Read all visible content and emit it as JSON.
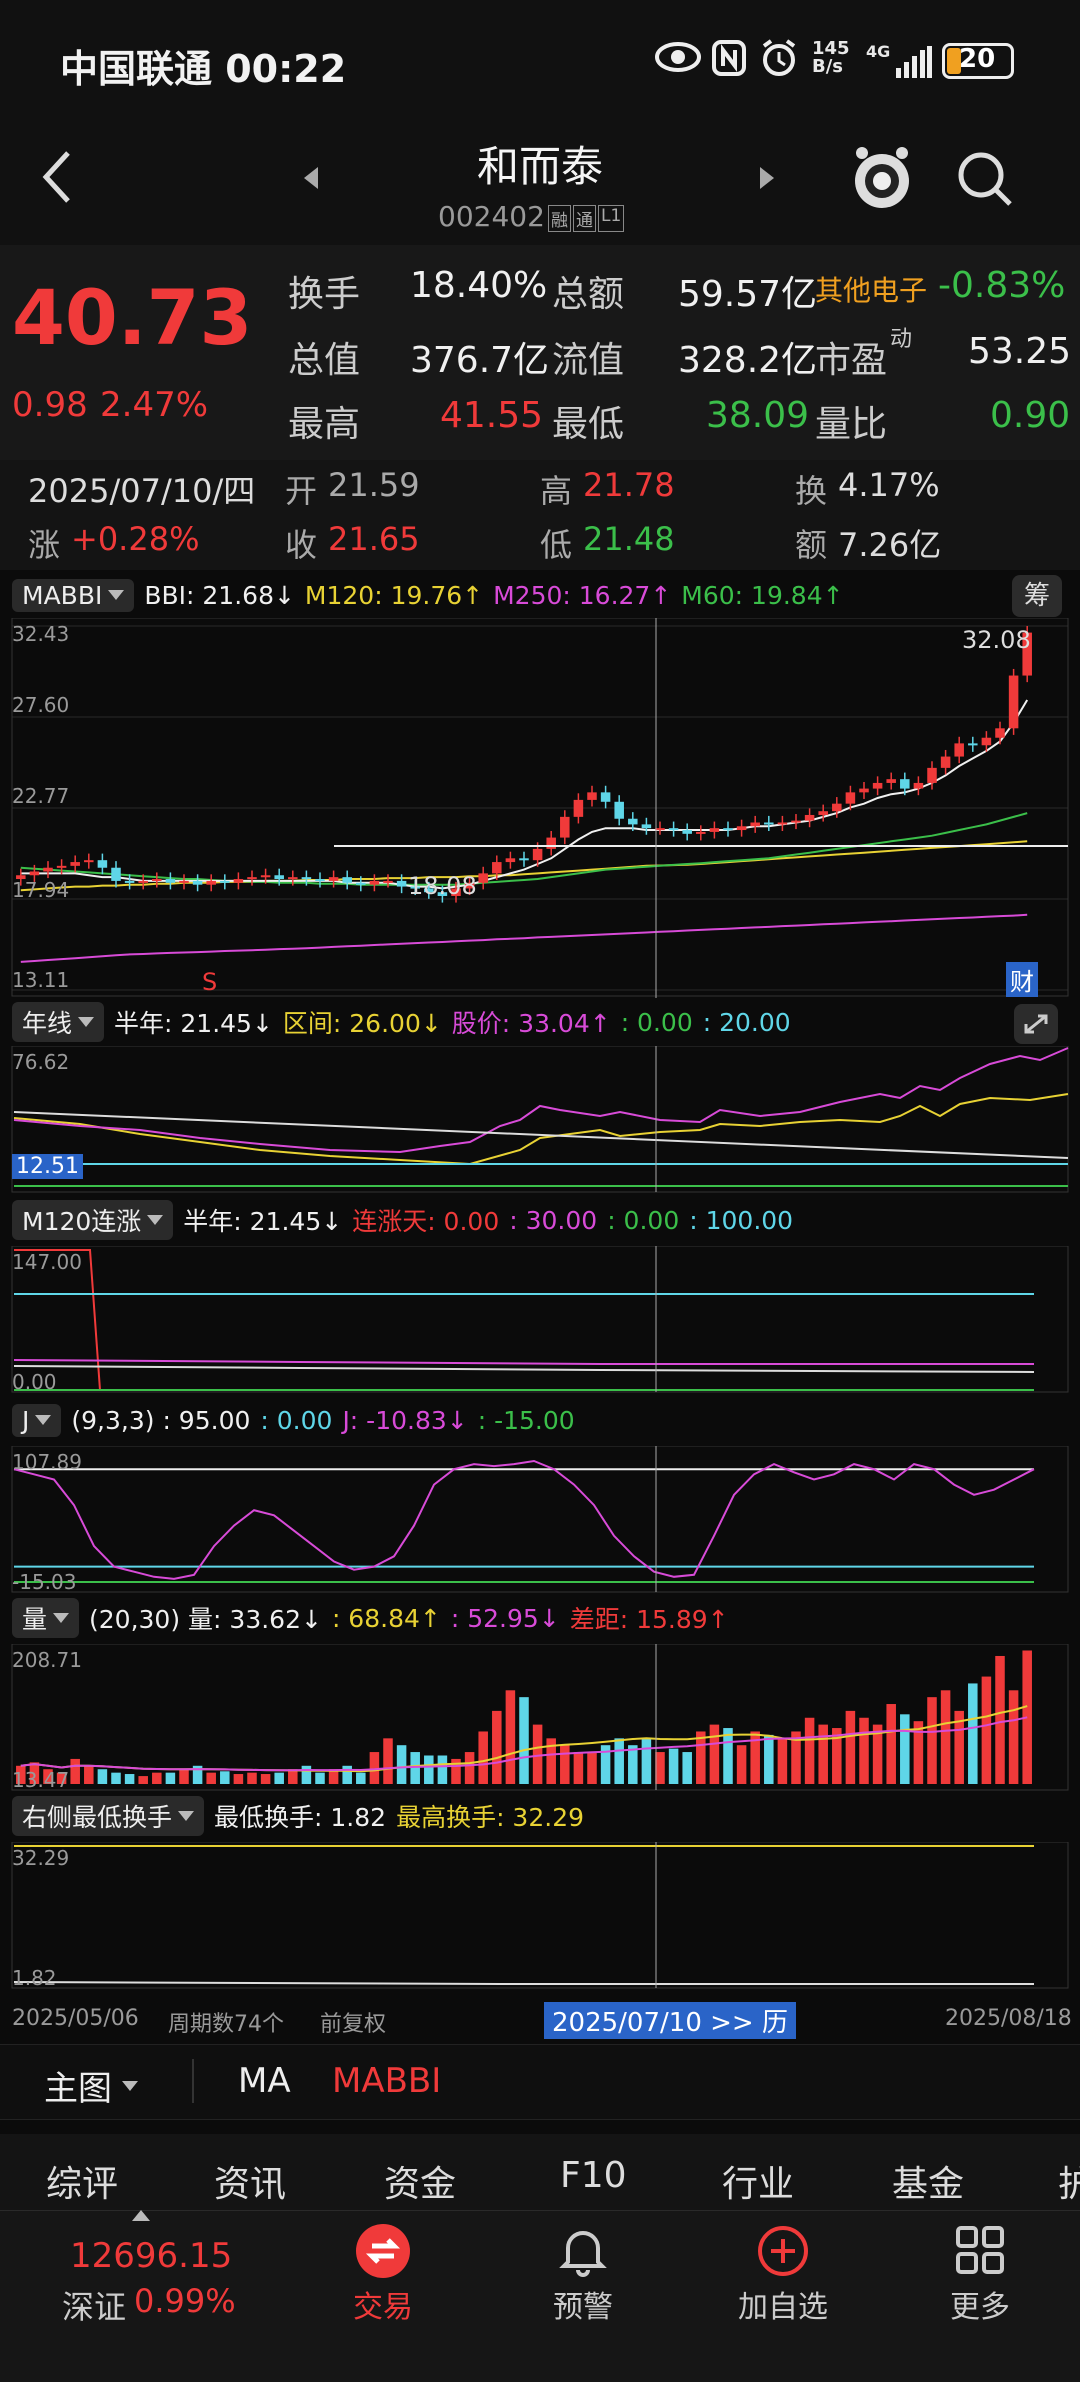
{
  "status": {
    "carrier_time": "中国联通 00:22",
    "net_speed": "145\nB/s",
    "net_type": "4G",
    "battery": "20"
  },
  "header": {
    "title": "和而泰",
    "code": "002402",
    "tags": [
      "融",
      "通",
      "L1"
    ]
  },
  "quote": {
    "price": "40.73",
    "change": "0.98",
    "change_pct": "2.47%",
    "rows": [
      [
        {
          "k": "换手",
          "v": "18.40%"
        },
        {
          "k": "总额",
          "v": "59.57亿"
        },
        {
          "k": "其他电子",
          "v": "-0.83%"
        }
      ],
      [
        {
          "k": "总值",
          "v": "376.7亿"
        },
        {
          "k": "流值",
          "v": "328.2亿"
        },
        {
          "k": "市盈",
          "sup": "动",
          "v": "53.25"
        }
      ],
      [
        {
          "k": "最高",
          "v": "41.55"
        },
        {
          "k": "最低",
          "v": "38.09"
        },
        {
          "k": "量比",
          "v": "0.90"
        }
      ]
    ]
  },
  "kinfo": {
    "date": "2025/07/10/四",
    "open_k": "开",
    "open_v": "21.59",
    "high_k": "高",
    "high_v": "21.78",
    "turn_k": "换",
    "turn_v": "4.17%",
    "chg_k": "涨",
    "chg_v": "+0.28%",
    "close_k": "收",
    "close_v": "21.65",
    "low_k": "低",
    "low_v": "21.48",
    "amt_k": "额",
    "amt_v": "7.26亿"
  },
  "main_panel": {
    "selector": "MABBI",
    "bbi": "BBI: 21.68↓",
    "m120": "M120: 19.76↑",
    "m250": "M250: 16.27↑",
    "m60": "M60: 19.84↑",
    "chip_btn": "筹",
    "y_labels": [
      "32.43",
      "27.60",
      "22.77",
      "17.94",
      "13.11"
    ],
    "max_label": "32.08",
    "min_label": "18.08",
    "s_mark": "S",
    "cai_mark": "财"
  },
  "panel2": {
    "selector": "年线",
    "p1": "半年: 21.45↓",
    "p2": "区间: 26.00↓",
    "p3": "股价: 33.04↑",
    "p4": ": 0.00",
    "p5": ": 20.00",
    "y_top": "76.62",
    "y_bot": "12.51"
  },
  "panel3": {
    "selector": "M120连涨",
    "p1": "半年: 21.45↓",
    "p2": "连涨天: 0.00",
    "p3": ": 30.00",
    "p4": ": 0.00",
    "p5": ": 100.00",
    "y_top": "147.00",
    "y_bot": "0.00"
  },
  "panel4": {
    "selector": "J",
    "p1": "(9,3,3) : 95.00",
    "p2": ": 0.00",
    "p3": "J: -10.83↓",
    "p4": ": -15.00",
    "y_top": "107.89",
    "y_bot": "-15.03"
  },
  "panel5": {
    "selector": "量",
    "p1": "(20,30) 量: 33.62↓",
    "p2": ": 68.84↑",
    "p3": ": 52.95↓",
    "p4": "差距: 15.89↑",
    "y_top": "208.71",
    "y_bot": "13.47"
  },
  "panel6": {
    "selector": "右侧最低换手",
    "p1": "最低换手: 1.82",
    "p2": "最高换手: 32.29",
    "y_top": "32.29",
    "y_bot": "1.82"
  },
  "footer_axis": {
    "start": "2025/05/06",
    "period": "周期数74个",
    "adj": "前复权",
    "cursor": "2025/07/10 >> 历",
    "end": "2025/08/18"
  },
  "toolbar": {
    "main": "主图",
    "ma": "MA",
    "mabbi": "MABBI"
  },
  "tabs": [
    "综评",
    "资讯",
    "资金",
    "F10",
    "行业",
    "基金",
    "护"
  ],
  "bottom": {
    "index_val": "12696.15",
    "index_name": "深证",
    "index_pct": "0.99%",
    "items": [
      "交易",
      "预警",
      "加自选",
      "更多"
    ]
  },
  "colors": {
    "up": "#f03a3a",
    "down": "#3bbf4a",
    "cyan": "#5fd6e8",
    "yellow": "#e8d234",
    "magenta": "#d84bd8"
  },
  "chart_data": {
    "type": "candlestick",
    "ylim": [
      13.11,
      32.43
    ],
    "closes": [
      19.2,
      19.4,
      19.6,
      19.7,
      19.9,
      20.0,
      19.6,
      18.9,
      18.8,
      18.9,
      19.0,
      18.8,
      18.9,
      18.7,
      18.9,
      18.8,
      19.0,
      19.1,
      19.2,
      19.0,
      19.1,
      19.0,
      18.9,
      19.1,
      18.8,
      18.7,
      18.9,
      18.9,
      18.6,
      18.5,
      18.3,
      18.1,
      18.5,
      18.8,
      19.3,
      19.9,
      20.1,
      20.0,
      20.6,
      21.2,
      22.3,
      23.2,
      23.6,
      23.1,
      22.2,
      21.9,
      21.7,
      21.7,
      21.6,
      21.4,
      21.5,
      21.7,
      21.6,
      21.8,
      22.0,
      21.9,
      22.0,
      22.1,
      22.4,
      22.6,
      23.0,
      23.6,
      23.8,
      24.1,
      24.3,
      23.8,
      24.1,
      24.9,
      25.5,
      26.2,
      26.1,
      26.5,
      27.0,
      29.8,
      32.08
    ],
    "volume": [
      40,
      45,
      35,
      30,
      50,
      40,
      35,
      30,
      28,
      25,
      30,
      30,
      35,
      40,
      30,
      32,
      28,
      30,
      28,
      30,
      35,
      40,
      30,
      35,
      40,
      30,
      60,
      80,
      70,
      60,
      55,
      55,
      50,
      60,
      90,
      120,
      150,
      140,
      100,
      80,
      70,
      60,
      60,
      70,
      80,
      70,
      80,
      60,
      65,
      60,
      90,
      100,
      95,
      70,
      90,
      85,
      80,
      90,
      110,
      100,
      95,
      120,
      110,
      100,
      130,
      115,
      105,
      140,
      150,
      120,
      160,
      170,
      200,
      150,
      208
    ],
    "bbi": [
      19.3,
      19.3,
      19.3,
      19.3,
      19.3,
      19.2,
      19.1,
      19.1,
      19.0,
      18.9,
      18.9,
      18.9,
      18.9,
      18.9,
      18.9,
      18.9,
      18.9,
      18.9,
      18.9,
      18.9,
      18.9,
      18.9,
      18.9,
      18.9,
      18.8,
      18.8,
      18.8,
      18.8,
      18.7,
      18.6,
      18.6,
      18.5,
      18.6,
      18.7,
      18.9,
      19.1,
      19.3,
      19.5,
      19.8,
      20.1,
      20.6,
      21.1,
      21.5,
      21.7,
      21.7,
      21.7,
      21.6,
      21.6,
      21.6,
      21.6,
      21.6,
      21.6,
      21.6,
      21.7,
      21.8,
      21.8,
      21.9,
      22.0,
      22.1,
      22.3,
      22.5,
      22.8,
      23.0,
      23.3,
      23.5,
      23.6,
      23.8,
      24.1,
      24.5,
      25.0,
      25.4,
      25.8,
      26.3,
      27.3,
      28.5
    ],
    "m60": [
      19.6,
      19.55,
      19.5,
      19.45,
      19.4,
      19.35,
      19.3,
      19.25,
      19.2,
      19.15,
      19.1,
      19.05,
      19.0,
      19.0,
      18.95,
      18.9,
      18.9,
      18.85,
      18.85,
      18.8,
      18.8,
      18.8,
      18.75,
      18.75,
      18.75,
      18.7,
      18.7,
      18.7,
      18.7,
      18.7,
      18.7,
      18.7,
      18.7,
      18.75,
      18.8,
      18.85,
      18.9,
      18.95,
      19.0,
      19.1,
      19.2,
      19.3,
      19.4,
      19.5,
      19.55,
      19.6,
      19.65,
      19.7,
      19.75,
      19.8,
      19.84,
      19.9,
      19.95,
      20.0,
      20.05,
      20.1,
      20.2,
      20.3,
      20.4,
      20.5,
      20.6,
      20.7,
      20.8,
      20.9,
      21.0,
      21.1,
      21.2,
      21.3,
      21.45,
      21.6,
      21.75,
      21.9,
      22.1,
      22.3,
      22.5
    ],
    "m120": [
      18.4,
      18.45,
      18.5,
      18.55,
      18.6,
      18.6,
      18.65,
      18.65,
      18.7,
      18.7,
      18.75,
      18.75,
      18.8,
      18.8,
      18.8,
      18.85,
      18.85,
      18.85,
      18.9,
      18.9,
      18.9,
      18.95,
      18.95,
      18.95,
      19.0,
      19.0,
      19.0,
      19.05,
      19.05,
      19.05,
      19.1,
      19.1,
      19.1,
      19.15,
      19.15,
      19.2,
      19.2,
      19.25,
      19.3,
      19.35,
      19.4,
      19.45,
      19.5,
      19.55,
      19.6,
      19.65,
      19.7,
      19.72,
      19.74,
      19.76,
      19.8,
      19.85,
      19.9,
      19.95,
      20.0,
      20.05,
      20.1,
      20.15,
      20.2,
      20.25,
      20.3,
      20.35,
      20.4,
      20.45,
      20.5,
      20.55,
      20.6,
      20.65,
      20.7,
      20.75,
      20.8,
      20.85,
      20.9,
      20.95,
      21.0
    ],
    "m250": [
      14.6,
      14.65,
      14.7,
      14.75,
      14.8,
      14.85,
      14.9,
      14.95,
      15.0,
      15.02,
      15.05,
      15.08,
      15.1,
      15.12,
      15.15,
      15.18,
      15.2,
      15.22,
      15.25,
      15.28,
      15.3,
      15.33,
      15.36,
      15.4,
      15.43,
      15.46,
      15.5,
      15.53,
      15.56,
      15.6,
      15.63,
      15.66,
      15.7,
      15.73,
      15.76,
      15.8,
      15.83,
      15.86,
      15.9,
      15.93,
      15.96,
      16.0,
      16.03,
      16.06,
      16.1,
      16.13,
      16.16,
      16.2,
      16.23,
      16.27,
      16.3,
      16.33,
      16.36,
      16.4,
      16.43,
      16.46,
      16.5,
      16.53,
      16.56,
      16.6,
      16.63,
      16.66,
      16.7,
      16.73,
      16.76,
      16.8,
      16.83,
      16.86,
      16.9,
      16.93,
      16.96,
      17.0,
      17.03,
      17.06,
      17.1
    ],
    "j_line": [
      95,
      90,
      85,
      60,
      20,
      0,
      -5,
      -10,
      -12,
      -8,
      20,
      40,
      55,
      50,
      35,
      20,
      5,
      -3,
      0,
      10,
      40,
      80,
      95,
      100,
      98,
      100,
      103,
      95,
      80,
      60,
      30,
      10,
      -5,
      -10,
      -8,
      30,
      70,
      90,
      100,
      92,
      85,
      90,
      100,
      95,
      85,
      100,
      95,
      80,
      70,
      75,
      85,
      95
    ]
  }
}
